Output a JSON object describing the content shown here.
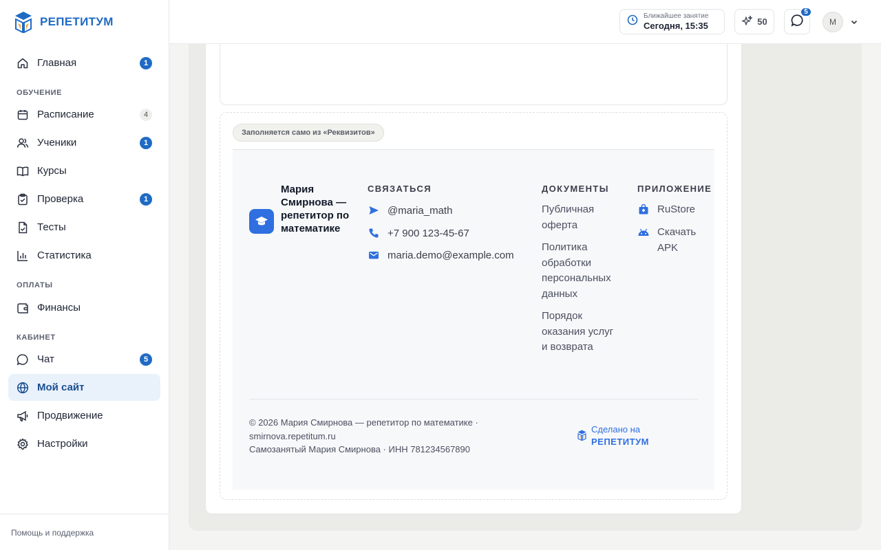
{
  "app": {
    "logo_text": "РЕПЕТИТУМ"
  },
  "sidebar": {
    "main": {
      "label": "Главная",
      "badge": "1"
    },
    "sections": {
      "learning": "ОБУЧЕНИЕ",
      "payments": "ОПЛАТЫ",
      "cabinet": "КАБИНЕТ"
    },
    "items": {
      "schedule": {
        "label": "Расписание",
        "badge": "4"
      },
      "students": {
        "label": "Ученики",
        "badge": "1"
      },
      "courses": {
        "label": "Курсы"
      },
      "review": {
        "label": "Проверка",
        "badge": "1"
      },
      "tests": {
        "label": "Тесты"
      },
      "stats": {
        "label": "Статистика"
      },
      "finance": {
        "label": "Финансы"
      },
      "chat": {
        "label": "Чат",
        "badge": "5"
      },
      "site": {
        "label": "Мой сайт",
        "active": true
      },
      "promo": {
        "label": "Продвижение"
      },
      "settings": {
        "label": "Настройки"
      }
    },
    "help": "Помощь и поддержка"
  },
  "header": {
    "next_lesson_label": "Ближайшее занятие",
    "next_lesson_value": "Сегодня, 15:35",
    "points": "50",
    "chat_badge": "5",
    "avatar_initial": "М"
  },
  "editor": {
    "autofill_chip": "Заполняется само из «Реквизитов»"
  },
  "footer_preview": {
    "brand_name": "Мария Смирнова — репетитор по математике",
    "contact_title": "СВЯЗАТЬСЯ",
    "contacts": {
      "telegram": "@maria_math",
      "phone": "+7 900 123-45-67",
      "email": "maria.demo@example.com"
    },
    "docs_title": "ДОКУМЕНТЫ",
    "docs": {
      "offer": "Публичная оферта",
      "privacy": "Политика обработки персональных данных",
      "refund": "Порядок оказания услуг и возврата"
    },
    "app_title": "ПРИЛОЖЕНИЕ",
    "apps": {
      "rustore": "RuStore",
      "apk": "Скачать APK"
    },
    "copyright_line1": "© 2026 Мария Смирнова — репетитор по математике ·",
    "copyright_line2": "smirnova.repetitum.ru",
    "copyright_line3": "Самозанятый Мария Смирнова · ИНН 781234567890",
    "made_on": "Сделано на",
    "made_brand": "РЕПЕТИТУМ"
  },
  "colors": {
    "accent": "#1f6bc4",
    "brand_blue": "#2f6fe0",
    "active_bg": "#e9f1fb"
  }
}
